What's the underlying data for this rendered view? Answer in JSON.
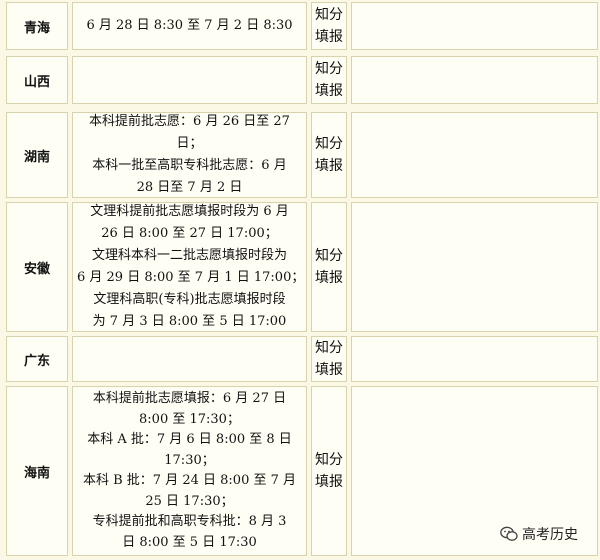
{
  "rows": [
    {
      "province": "青海",
      "time_lines": [
        "6 月 28 日 8:30 至 7 月 2 日 8:30"
      ],
      "method_lines": [
        "知分",
        "填报"
      ]
    },
    {
      "province": "山西",
      "time_lines": [],
      "method_lines": [
        "知分",
        "填报"
      ]
    },
    {
      "province": "湖南",
      "time_lines": [
        "本科提前批志愿：6 月 26 日至 27",
        "日；",
        "本科一批至高职专科批志愿：6 月",
        "28 日至 7 月 2 日"
      ],
      "method_lines": [
        "知分",
        "填报"
      ]
    },
    {
      "province": "安徽",
      "time_lines": [
        "文理科提前批志愿填报时段为 6 月",
        "26 日 8:00 至 27 日 17:00；",
        "文理科本科一二批志愿填报时段为",
        "6 月 29 日 8:00 至 7 月 1 日 17:00；",
        "文理科高职(专科)批志愿填报时段",
        "为 7 月 3 日 8:00 至 5 日 17:00"
      ],
      "method_lines": [
        "知分",
        "填报"
      ]
    },
    {
      "province": "广东",
      "time_lines": [],
      "method_lines": [
        "知分",
        "填报"
      ]
    },
    {
      "province": "海南",
      "time_lines": [
        "本科提前批志愿填报：6 月 27 日",
        "8:00 至 17:30；",
        "本科 A 批：7 月 6 日 8:00 至 8 日",
        "17:30；",
        "本科 B 批：7 月 24 日 8:00 至 7 月",
        "25 日 17:30；",
        "专科提前批和高职专科批：8 月 3",
        "日 8:00 至 5 日 17:30"
      ],
      "method_lines": [
        "知分",
        "填报"
      ]
    }
  ],
  "watermark": {
    "text": "高考历史",
    "icon": "wechat-icon"
  }
}
